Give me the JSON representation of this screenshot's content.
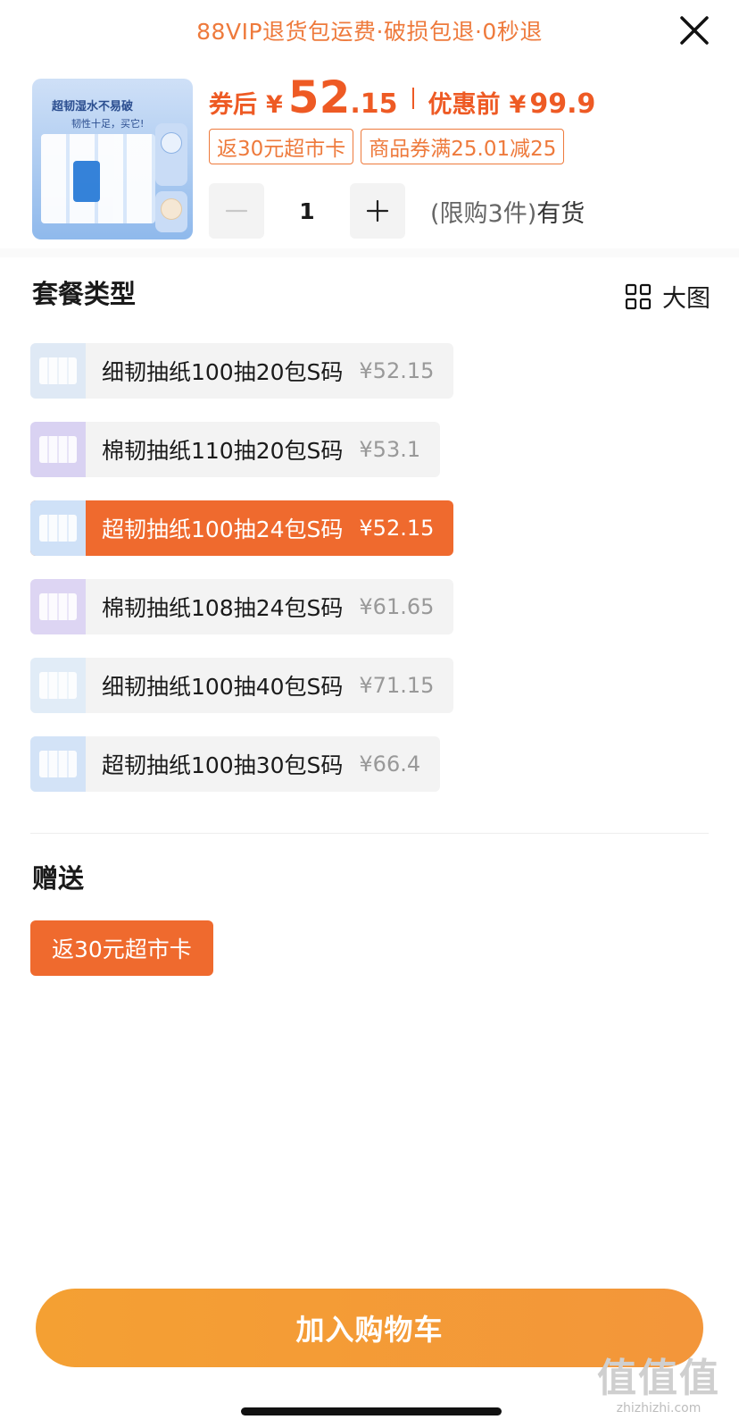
{
  "banner": {
    "text": "88VIP退货包运费·破损包退·0秒退"
  },
  "product": {
    "image_title": "超韧湿水不易破",
    "image_subtitle": "韧性十足，买它!",
    "price_after_label": "券后",
    "currency": "¥",
    "price_after_int": "52",
    "price_after_dec": ".15",
    "price_before_label": "优惠前",
    "price_before_value": "99.9",
    "tags": [
      "返30元超市卡",
      "商品券满25.01减25"
    ],
    "quantity": "1",
    "stock_limit": "(限购3件)",
    "stock_status": "有货"
  },
  "package_section": {
    "title": "套餐类型",
    "big_view_label": "大图",
    "options": [
      {
        "name": "细韧抽纸100抽20包S码",
        "price": "¥52.15",
        "selected": false,
        "thumb_color": "#dfe9f5"
      },
      {
        "name": "棉韧抽纸110抽20包S码",
        "price": "¥53.1",
        "selected": false,
        "thumb_color": "#d9d2f2"
      },
      {
        "name": "超韧抽纸100抽24包S码",
        "price": "¥52.15",
        "selected": true,
        "thumb_color": "#cfe1f7"
      },
      {
        "name": "棉韧抽纸108抽24包S码",
        "price": "¥61.65",
        "selected": false,
        "thumb_color": "#ddd5f3"
      },
      {
        "name": "细韧抽纸100抽40包S码",
        "price": "¥71.15",
        "selected": false,
        "thumb_color": "#e1ecf7"
      },
      {
        "name": "超韧抽纸100抽30包S码",
        "price": "¥66.4",
        "selected": false,
        "thumb_color": "#d3e3f7"
      }
    ]
  },
  "gift_section": {
    "title": "赠送",
    "gift_label": "返30元超市卡"
  },
  "cart": {
    "button_label": "加入购物车"
  },
  "watermark": {
    "logo": "值值值",
    "url": "zhizhizhi.com"
  },
  "colors": {
    "accent": "#ef6a2e",
    "price": "#ee5a24",
    "cart_button": "#f4a033"
  }
}
